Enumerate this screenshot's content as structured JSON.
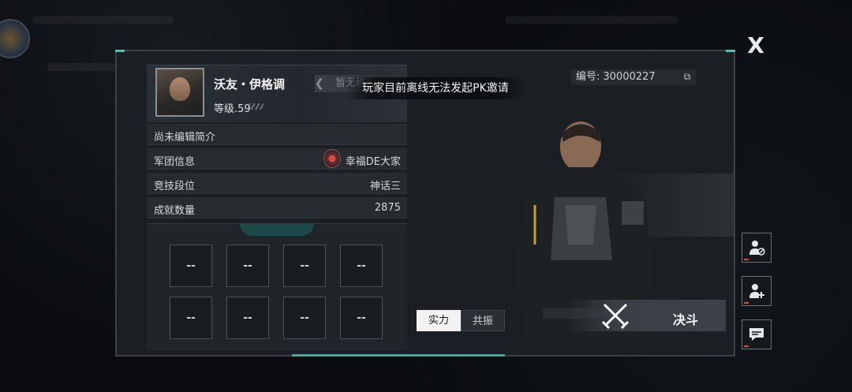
{
  "window": {
    "close_label": "X"
  },
  "profile": {
    "name": "沃友・伊格调",
    "level": "等级.59",
    "tag": "暂无称号",
    "bio": "尚未编辑简介",
    "id_label": "编号: 30000227"
  },
  "toast": {
    "message": "玩家目前离线无法发起PK邀请"
  },
  "info_rows": [
    {
      "label": "军团信息",
      "value": "幸福DE大家"
    },
    {
      "label": "竞技段位",
      "value": "神话三"
    },
    {
      "label": "成就数量",
      "value": "2875"
    }
  ],
  "slots": [
    "--",
    "--",
    "--",
    "--",
    "--",
    "--",
    "--",
    "--"
  ],
  "tabs": {
    "active": "实力",
    "inactive": "共振"
  },
  "duel": {
    "label": "决斗"
  },
  "colors": {
    "accent": "#2ecfb8",
    "panel": "#1b1f24",
    "badge": "#e04848"
  },
  "icons": [
    "close-icon",
    "copy-icon",
    "legion-emblem-icon",
    "crossed-swords-icon",
    "block-user-icon",
    "add-friend-icon",
    "chat-icon"
  ]
}
